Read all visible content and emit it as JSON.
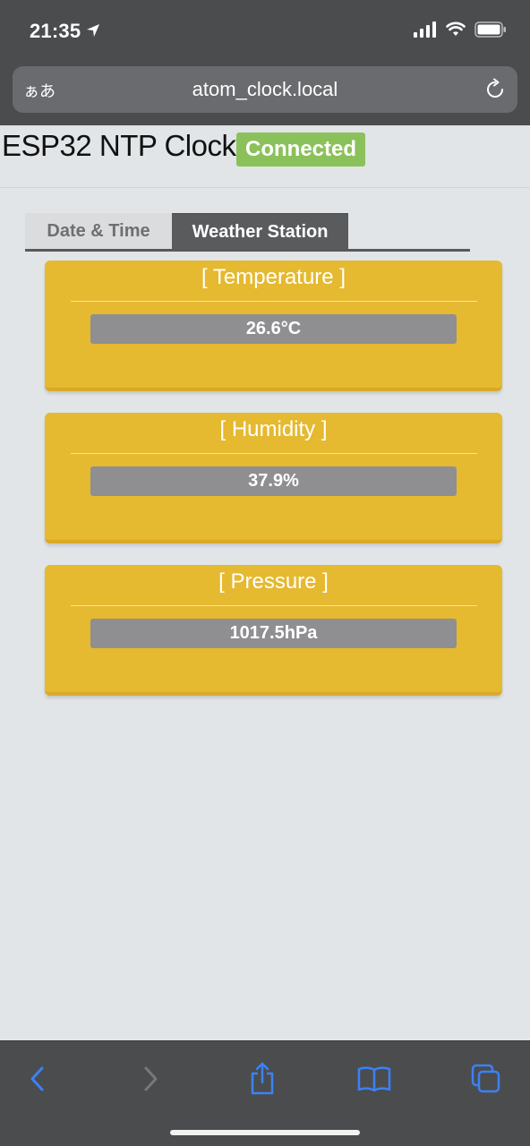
{
  "status_bar": {
    "time": "21:35"
  },
  "browser": {
    "aa_label": "ぁあ",
    "url": "atom_clock.local"
  },
  "page": {
    "title": "ESP32 NTP Clock",
    "connection_status": "Connected",
    "tabs": [
      {
        "label": "Date & Time",
        "active": false
      },
      {
        "label": "Weather Station",
        "active": true
      }
    ],
    "cards": [
      {
        "title": "[ Temperature ]",
        "value": "26.6°C"
      },
      {
        "title": "[ Humidity ]",
        "value": "37.9%"
      },
      {
        "title": "[ Pressure ]",
        "value": "1017.5hPa"
      }
    ]
  },
  "colors": {
    "card_bg": "#e5b930",
    "badge_bg": "#8bc15a",
    "accent": "#3a82f7"
  },
  "icons": {
    "status": [
      "location-arrow-icon",
      "signal-icon",
      "wifi-icon",
      "battery-icon"
    ],
    "toolbar": [
      "back-icon",
      "forward-icon",
      "share-icon",
      "bookmarks-icon",
      "tabs-icon"
    ]
  }
}
